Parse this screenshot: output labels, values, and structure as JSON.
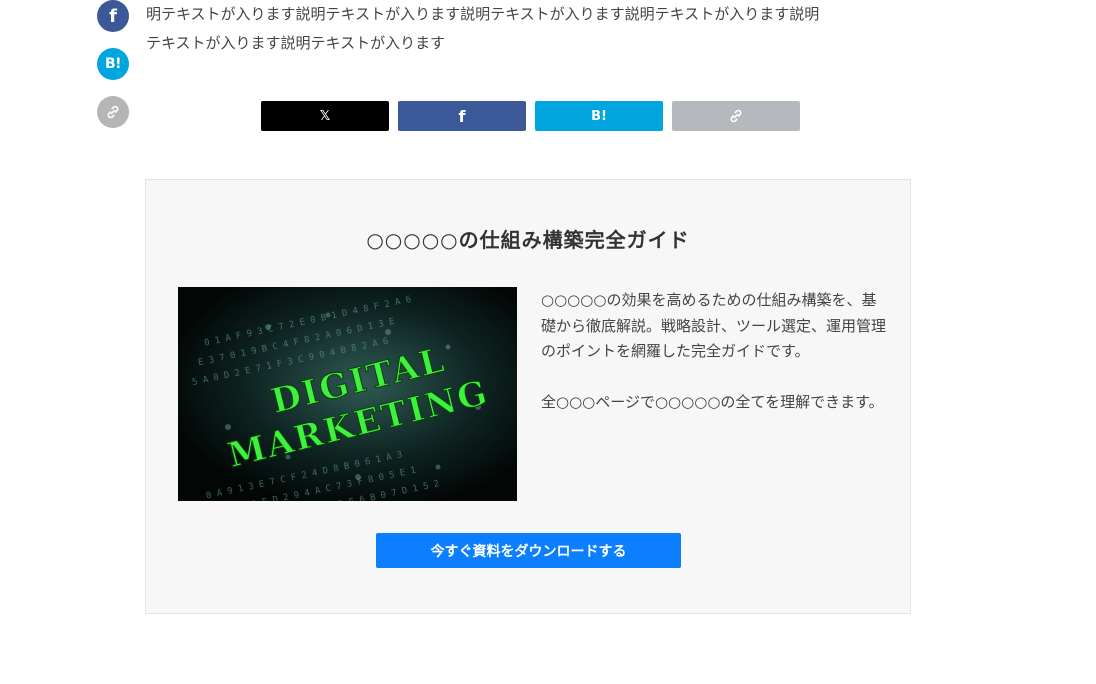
{
  "intro": {
    "lines": [
      "明テキストが入ります説明テキストが入ります説明テキストが入ります説明テキストが入ります説明",
      "テキストが入ります説明テキストが入ります"
    ]
  },
  "side_share": {
    "facebook_label": "f",
    "hatena_label": "B!",
    "link_icon": "link-icon"
  },
  "share_bar": {
    "x_label": "𝕏",
    "facebook_label": "f",
    "hatena_label": "B!",
    "link_icon": "link-icon"
  },
  "card": {
    "title": "○○○○○の仕組み構築完全ガイド",
    "image": {
      "line1": "DIGITAL",
      "line2": "MARKETING"
    },
    "desc_para1": "○○○○○の効果を高めるための仕組み構築を、基礎から徹底解説。戦略設計、ツール選定、運用管理のポイントを網羅した完全ガイドです。",
    "desc_para2": "全○○○ページで○○○○○の全てを理解できます。",
    "cta_label": "今すぐ資料をダウンロードする"
  },
  "colors": {
    "facebook": "#3b5998",
    "hatena": "#00a4de",
    "x": "#000000",
    "link": "#b5b8bd",
    "cta": "#0b7fff",
    "card_bg": "#f7f7f7",
    "digital_green": "#39e639"
  }
}
